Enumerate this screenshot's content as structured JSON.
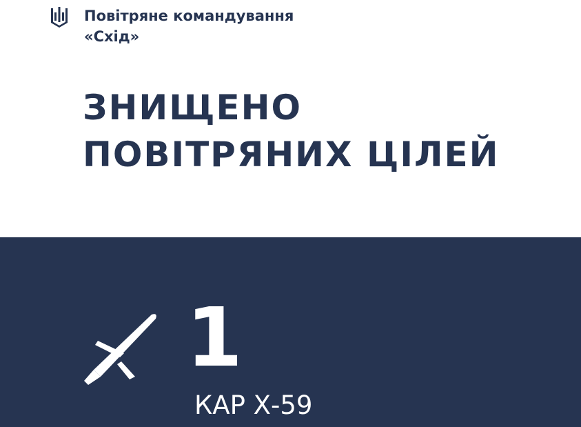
{
  "header": {
    "emblem_icon": "trident-icon",
    "org_line1": "Повітряне командування",
    "org_line2": "«Схід»"
  },
  "headline": {
    "line1": "ЗНИЩЕНО",
    "line2": "ПОВІТРЯНИХ ЦІЛЕЙ"
  },
  "targets": {
    "icon": "cruise-missile-icon",
    "count": "1",
    "type": "КАР Х-59"
  },
  "colors": {
    "brand_navy": "#263451",
    "text_light": "#ffffff",
    "background": "#ffffff"
  }
}
